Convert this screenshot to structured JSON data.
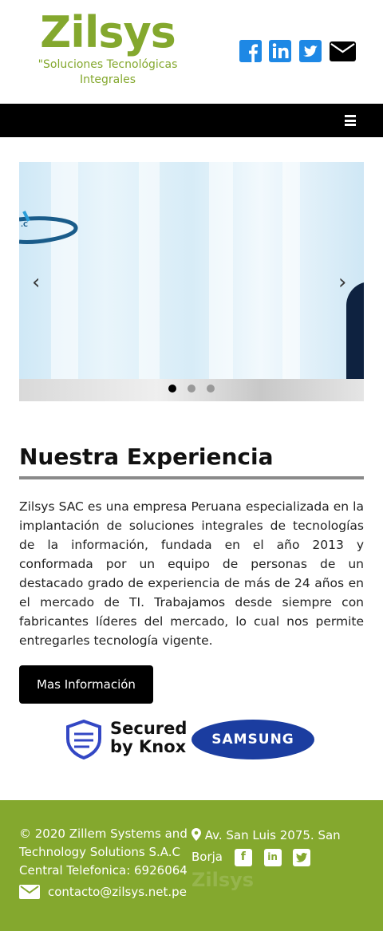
{
  "header": {
    "logo_text": "Zilsys",
    "tagline": "\"Soluciones Tecnológicas Integrales",
    "social": [
      {
        "icon": "facebook-icon",
        "glyph": "f",
        "color": "#1e88e5"
      },
      {
        "icon": "linkedin-icon",
        "glyph": "in",
        "color": "#1e88e5"
      },
      {
        "icon": "twitter-icon",
        "glyph": "t",
        "color": "#1e88e5"
      },
      {
        "icon": "envelope-icon",
        "color": "#000000"
      }
    ]
  },
  "nav": {
    "menu_icon": "hamburger-icon"
  },
  "carousel": {
    "prev_label": "‹",
    "next_label": "›",
    "slides": 3,
    "active_slide": 1,
    "logo_fragment": ".C"
  },
  "content": {
    "heading": "Nuestra Experiencia",
    "body": "Zilsys SAC es una empresa Peruana especializada en la implantación de soluciones integrales de tecnologías de la información, fundada en el año 2013 y conformada por un equipo de personas de un destacado grado de experiencia de más de 24 años en el mercado de TI. Trabajamos desde siempre con fabricantes líderes del mercado, lo cual nos permite entregarles tecnología vigente.",
    "button_label": "Mas Información"
  },
  "badges": {
    "knox_line1": "Secured",
    "knox_line2": "by Knox",
    "samsung": "SAMSUNG"
  },
  "footer": {
    "copyright": "© 2020 Zillem Systems and Technology Solutions S.A.C",
    "phone": "Central Telefonica: 6926064",
    "email": "contacto@zilsys.net.pe",
    "address": "Av. San Luis 2075. San Borja",
    "watermark": "Zilsys",
    "bg_color": "#84a82e"
  }
}
